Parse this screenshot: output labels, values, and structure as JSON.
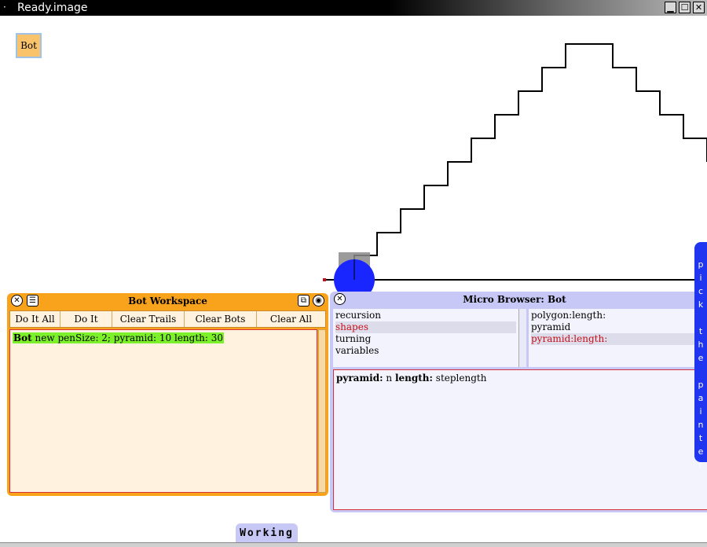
{
  "window": {
    "title": "Ready.image",
    "menu_glyph": "·",
    "minimize_glyph": "▁",
    "maximize_glyph": "☐",
    "close_glyph": "✕"
  },
  "desktop": {
    "bot_button_label": "Bot",
    "working_label": "Working",
    "flap_label": "Pick the Painter"
  },
  "workspace": {
    "title": "Bot Workspace",
    "buttons": [
      "Do It All",
      "Do It",
      "Clear Trails",
      "Clear Bots",
      "Clear All"
    ],
    "code": "Bot new penSize: 2; pyramid: 10 length: 30"
  },
  "browser": {
    "title": "Micro Browser: Bot",
    "categories": [
      "recursion",
      "shapes",
      "turning",
      "variables"
    ],
    "selected_category": "shapes",
    "methods": [
      "polygon:length:",
      "pyramid",
      "pyramid:length:"
    ],
    "selected_method": "pyramid:length:",
    "code_sig_1": "pyramid:",
    "code_arg_1": "n",
    "code_sig_2": "length:",
    "code_arg_2": "steplength"
  },
  "colors": {
    "bot": "#1a26ff",
    "workspace": "#f9a21c",
    "browser": "#c7c8f5",
    "flap": "#1f35f0",
    "selection": "#c8101a",
    "code_highlight": "#7cf02a"
  }
}
